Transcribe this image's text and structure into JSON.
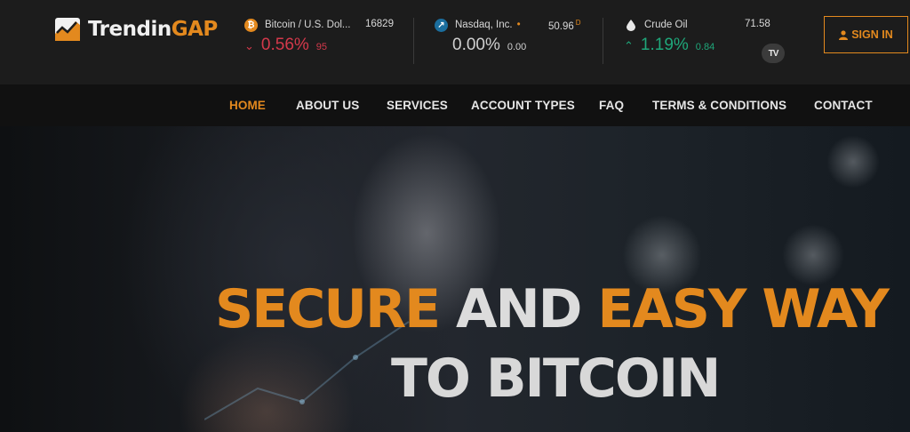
{
  "logo": {
    "text_white": "Trendin",
    "text_orange": "GAP",
    "icon": "chart-logo-icon"
  },
  "tickers": [
    {
      "icon": "bitcoin-icon",
      "icon_glyph": "₿",
      "icon_color": "#e3891e",
      "name": "Bitcoin / U.S. Dol...",
      "price": "16829",
      "direction": "down",
      "pct": "0.56%",
      "change": "95"
    },
    {
      "icon": "nasdaq-icon",
      "icon_glyph": "↗",
      "icon_color": "#1b6e9e",
      "name": "Nasdaq, Inc.",
      "dot": "•",
      "price": "50.96",
      "price_suffix": "D",
      "direction": "none",
      "pct": "0.00%",
      "change": "0.00"
    },
    {
      "icon": "oil-drop-icon",
      "icon_glyph": "●",
      "icon_color": "#1c1c1c",
      "name": "Crude Oil",
      "price": "71.58",
      "direction": "up",
      "pct": "1.19%",
      "change": "0.84"
    }
  ],
  "widget_badge": "TV",
  "signin": {
    "label": "SIGN IN",
    "icon": "user-icon"
  },
  "nav": [
    {
      "label": "HOME",
      "active": true
    },
    {
      "label": "ABOUT US"
    },
    {
      "label": "SERVICES"
    },
    {
      "label": "ACCOUNT TYPES"
    },
    {
      "label": "FAQ"
    },
    {
      "label": "TERMS & CONDITIONS"
    },
    {
      "label": "CONTACT"
    }
  ],
  "hero": {
    "line1_part1": "SECURE",
    "line1_part2": " AND ",
    "line1_part3": "EASY WAY",
    "line2": "TO BITCOIN"
  },
  "colors": {
    "accent": "#e3891e",
    "down": "#d4394b",
    "up": "#1fa77a",
    "header_bg": "#1c1c1c",
    "nav_bg": "#111111"
  }
}
